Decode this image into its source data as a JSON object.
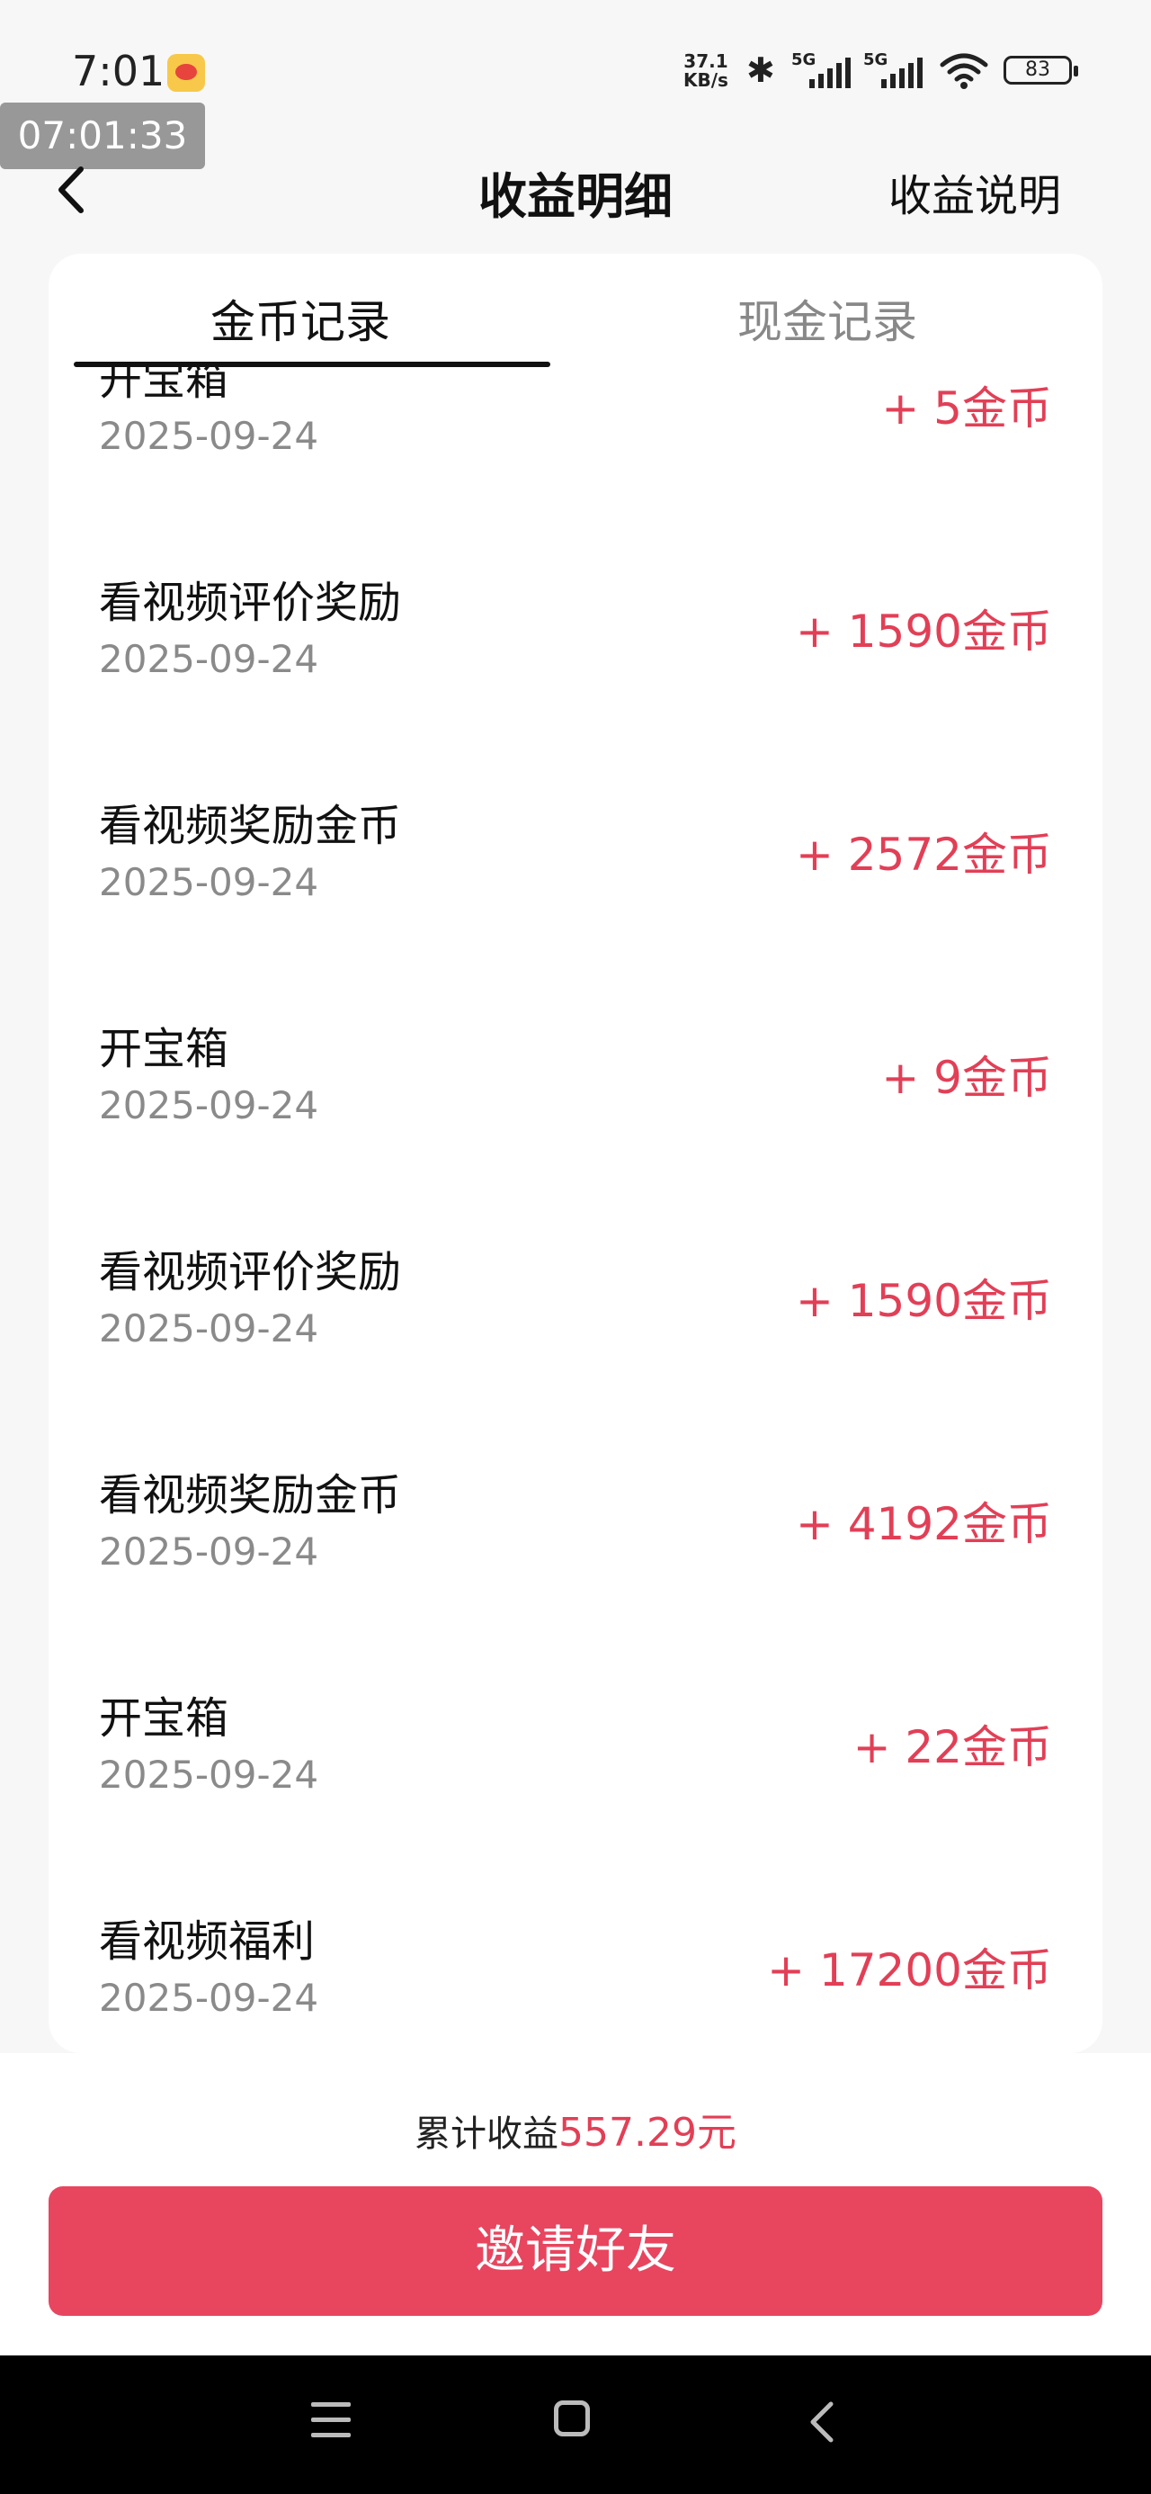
{
  "status_bar": {
    "time": "7:01",
    "net_speed_value": "37.1",
    "net_speed_unit": "KB/s",
    "signal1_label": "5G",
    "signal2_label": "5G",
    "battery": "83",
    "icons": [
      "weibo-icon",
      "bluetooth-icon",
      "signal-icon",
      "wifi-icon",
      "battery-icon"
    ]
  },
  "overlay": {
    "timestamp": "07:01:33"
  },
  "header": {
    "title": "收益明细",
    "help_link": "收益说明",
    "back_icon": "chevron-left-icon"
  },
  "tabs": [
    {
      "label": "金币记录",
      "active": true
    },
    {
      "label": "现金记录",
      "active": false
    }
  ],
  "records": [
    {
      "title": "开宝箱",
      "date": "2025-09-24",
      "amount": "+ 5金币"
    },
    {
      "title": "看视频评价奖励",
      "date": "2025-09-24",
      "amount": "+ 1590金币"
    },
    {
      "title": "看视频奖励金币",
      "date": "2025-09-24",
      "amount": "+ 2572金币"
    },
    {
      "title": "开宝箱",
      "date": "2025-09-24",
      "amount": "+ 9金币"
    },
    {
      "title": "看视频评价奖励",
      "date": "2025-09-24",
      "amount": "+ 1590金币"
    },
    {
      "title": "看视频奖励金币",
      "date": "2025-09-24",
      "amount": "+ 4192金币"
    },
    {
      "title": "开宝箱",
      "date": "2025-09-24",
      "amount": "+ 22金币"
    },
    {
      "title": "看视频福利",
      "date": "2025-09-24",
      "amount": "+ 17200金币"
    }
  ],
  "footer": {
    "total_label": "累计收益",
    "total_value": "557.29元",
    "invite_button": "邀请好友"
  },
  "colors": {
    "accent": "#e23f56",
    "button": "#e8455f",
    "background": "#f7f7f7"
  }
}
